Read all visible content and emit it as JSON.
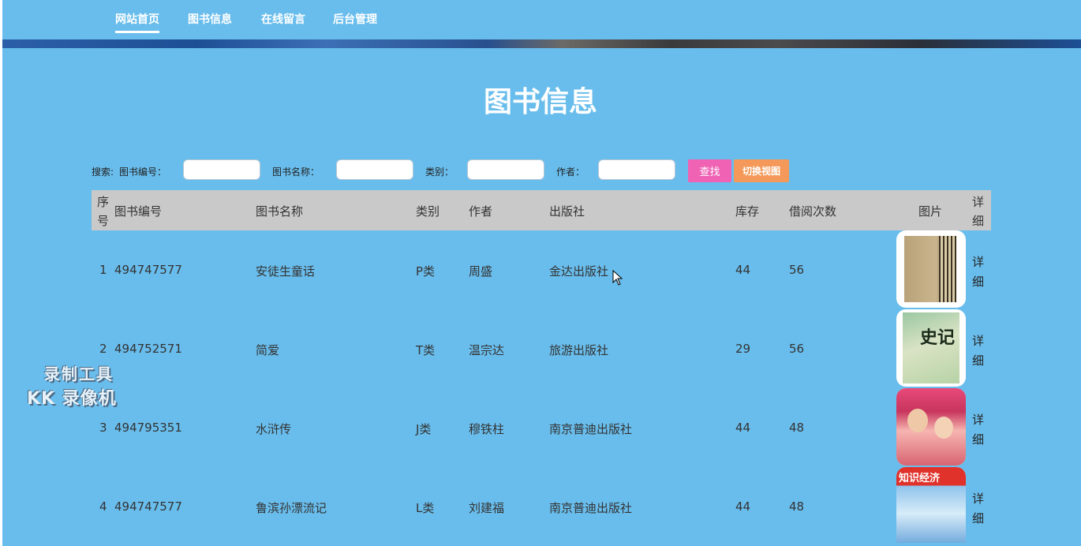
{
  "nav": {
    "items": [
      {
        "label": "网站首页",
        "active": true
      },
      {
        "label": "图书信息",
        "active": false
      },
      {
        "label": "在线留言",
        "active": false
      },
      {
        "label": "后台管理",
        "active": false
      }
    ]
  },
  "page": {
    "title": "图书信息"
  },
  "search": {
    "prefix": "搜索:",
    "book_no_label": "图书编号：",
    "book_name_label": "图书名称：",
    "category_label": "类别：",
    "author_label": "作者：",
    "book_no_value": "",
    "book_name_value": "",
    "category_value": "",
    "author_value": "",
    "search_button": "查找",
    "switch_view_button": "切换视图"
  },
  "table": {
    "headers": {
      "index": "序号",
      "book_no": "图书编号",
      "name": "图书名称",
      "category": "类别",
      "author": "作者",
      "publisher": "出版社",
      "stock": "库存",
      "borrow_count": "借阅次数",
      "image": "图片",
      "detail": "详细"
    },
    "rows": [
      {
        "index": "1",
        "book_no": "494747577",
        "name": "安徒生童话",
        "category": "P类",
        "author": "周盛",
        "publisher": "金达出版社",
        "stock": "44",
        "borrow_count": "56",
        "detail": "详细"
      },
      {
        "index": "2",
        "book_no": "494752571",
        "name": "简爱",
        "category": "T类",
        "author": "温宗达",
        "publisher": "旅游出版社",
        "stock": "29",
        "borrow_count": "56",
        "detail": "详细"
      },
      {
        "index": "3",
        "book_no": "494795351",
        "name": "水浒传",
        "category": "J类",
        "author": "穆铁柱",
        "publisher": "南京普迪出版社",
        "stock": "44",
        "borrow_count": "48",
        "detail": "详细"
      },
      {
        "index": "4",
        "book_no": "494747577",
        "name": "鲁滨孙漂流记",
        "category": "L类",
        "author": "刘建福",
        "publisher": "南京普迪出版社",
        "stock": "44",
        "borrow_count": "48",
        "detail": "详细"
      }
    ],
    "covers": {
      "cover2_text": "史记",
      "cover4_text": "知识经济"
    }
  },
  "watermark": {
    "line1": "录制工具",
    "line2": "KK 录像机"
  },
  "colors": {
    "background": "#69bdec",
    "header_row": "#c9c9c9",
    "search_button": "#ef62b4",
    "switch_button": "#f4995a"
  }
}
